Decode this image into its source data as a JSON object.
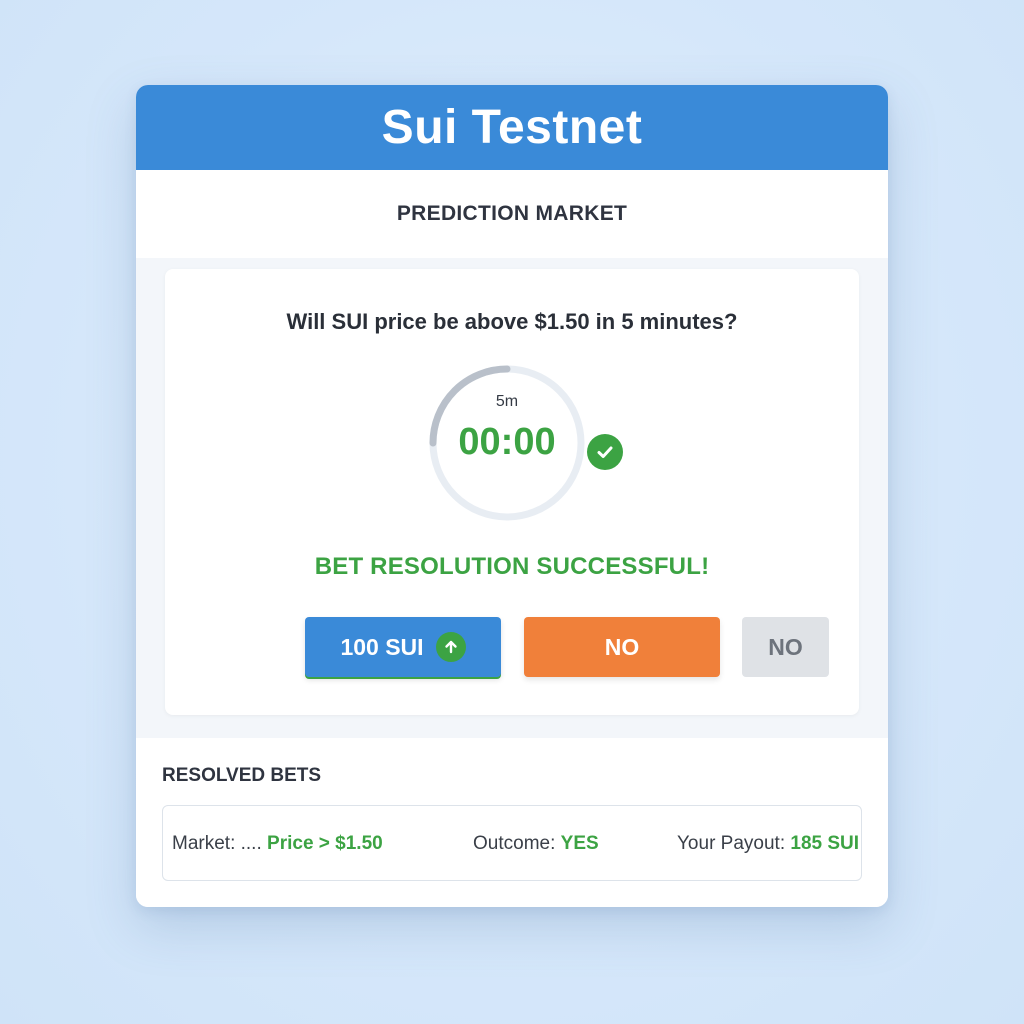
{
  "app": {
    "title": "Sui Testnet"
  },
  "section": {
    "title": "PREDICTION MARKET"
  },
  "market": {
    "question": "Will SUI price be above $1.50 in 5 minutes?",
    "timer": {
      "duration_label": "5m",
      "value": "00:00",
      "ring_progress": 0.25
    },
    "status": "BET RESOLUTION SUCCESSFUL!",
    "buttons": {
      "yes_label": "100 SUI",
      "no_label": "NO",
      "no_disabled_label": "NO"
    }
  },
  "resolved": {
    "title": "RESOLVED BETS",
    "row": {
      "market_label": "Market: ....",
      "market_value": "Price > $1.50",
      "outcome_label": "Outcome:",
      "outcome_value": "YES",
      "payout_label": "Your Payout:",
      "payout_value": "185 SUI"
    }
  },
  "colors": {
    "primary": "#3a8ad8",
    "success": "#3ca343",
    "danger": "#f0803a",
    "disabled": "#dfe2e6"
  },
  "icons": {
    "timer_status": "check-icon",
    "yes_button": "arrow-up-icon"
  }
}
